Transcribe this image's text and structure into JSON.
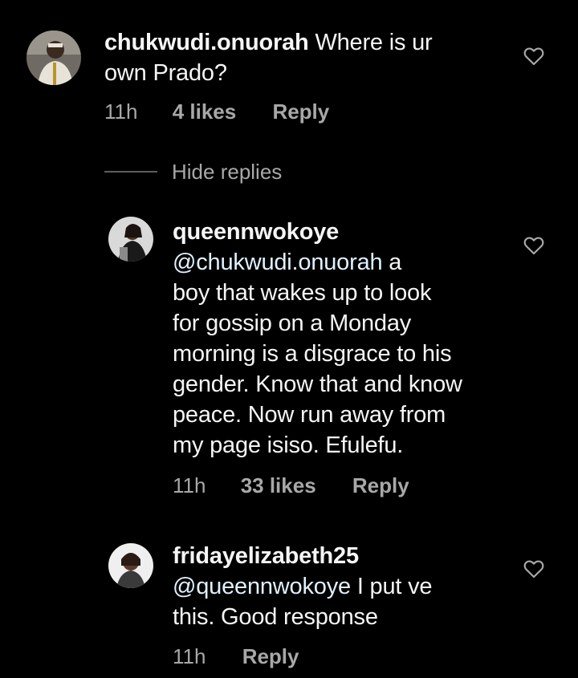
{
  "comments": [
    {
      "username": "chukwudi.onuorah",
      "mention": "",
      "text_line1": "Where is ur",
      "text_lines": [
        "own Prado?"
      ],
      "time": "11h",
      "likes": "4 likes",
      "reply": "Reply"
    },
    {
      "username": "queennwokoye",
      "mention": "@chukwudi.onuorah",
      "text_line1": "a",
      "text_lines": [
        "boy that wakes up to look",
        "for gossip on a Monday",
        "morning is a disgrace to his",
        "gender. Know that and know",
        "peace. Now run away from",
        "my page isiso. Efulefu."
      ],
      "time": "11h",
      "likes": "33 likes",
      "reply": "Reply"
    },
    {
      "username": "fridayelizabeth25",
      "mention": "@queennwokoye",
      "text_line1": "I put ve",
      "text_lines": [
        "this. Good response"
      ],
      "time": "11h",
      "likes": "",
      "reply": "Reply"
    }
  ],
  "hide_replies_label": "Hide replies",
  "icons": {
    "like": "heart-icon"
  }
}
